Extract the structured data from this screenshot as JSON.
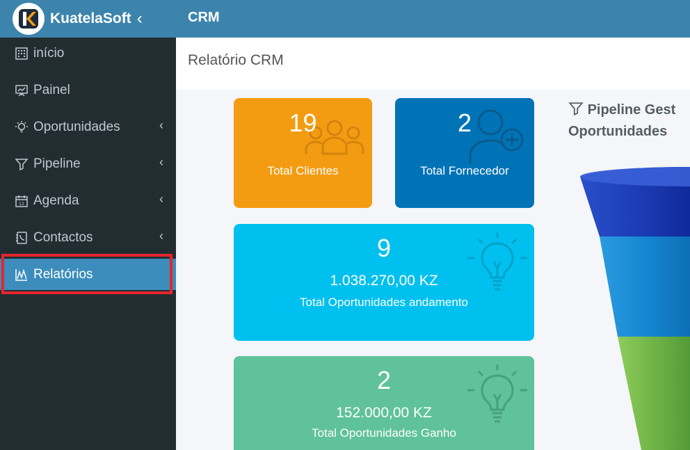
{
  "header": {
    "brand": "KuatelaSoft",
    "module": "CRM"
  },
  "sidebar": {
    "items": [
      {
        "label": "início",
        "icon": "building-icon",
        "has_submenu": false
      },
      {
        "label": "Painel",
        "icon": "presentation-icon",
        "has_submenu": false
      },
      {
        "label": "Oportunidades",
        "icon": "lightbulb-icon",
        "has_submenu": true
      },
      {
        "label": "Pipeline",
        "icon": "funnel-icon",
        "has_submenu": true
      },
      {
        "label": "Agenda",
        "icon": "calendar-icon",
        "has_submenu": true
      },
      {
        "label": "Contactos",
        "icon": "address-book-icon",
        "has_submenu": true
      },
      {
        "label": "Relatórios",
        "icon": "chart-icon",
        "has_submenu": false,
        "active": true
      }
    ]
  },
  "page": {
    "title": "Relatório CRM"
  },
  "cards": {
    "clientes": {
      "value": "19",
      "label": "Total Clientes",
      "color": "#f39c12"
    },
    "fornecedor": {
      "value": "2",
      "label": "Total Fornecedor",
      "color": "#0073b7"
    },
    "andamento": {
      "value": "9",
      "amount": "1.038.270,00 KZ",
      "label": "Total Oportunidades andamento",
      "color": "#00c0ef"
    },
    "ganho": {
      "value": "2",
      "amount": "152.000,00 KZ",
      "label": "Total Oportunidades Ganho",
      "color": "#5fc29a"
    }
  },
  "pipeline": {
    "title_line1": "Pipeline Gest",
    "title_line2": "Oportunidades"
  },
  "colors": {
    "header": "#3c84ac",
    "sidebar": "#222d32",
    "active_item": "#3c8dbc",
    "highlight": "#e3262e"
  }
}
